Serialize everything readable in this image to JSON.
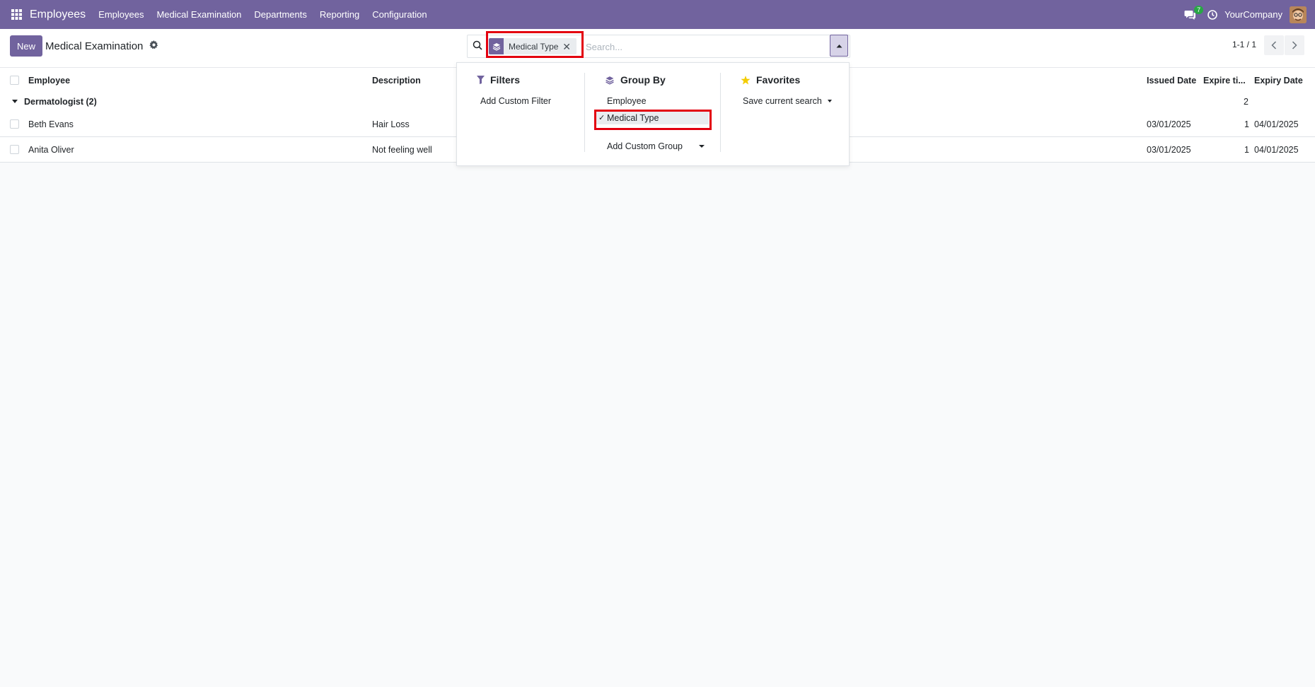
{
  "navbar": {
    "app_name": "Employees",
    "menu": [
      "Employees",
      "Medical Examination",
      "Departments",
      "Reporting",
      "Configuration"
    ],
    "chat_count": "7",
    "company": "YourCompany",
    "bg_color": "#71639e"
  },
  "control": {
    "new_label": "New",
    "title": "Medical Examination",
    "search": {
      "facet_label": "Medical Type",
      "placeholder": "Search..."
    },
    "pager": "1-1 / 1"
  },
  "list": {
    "columns": [
      "Employee",
      "Description",
      "Issued Date",
      "Expire ti...",
      "Expiry Date"
    ],
    "group": {
      "label": "Dermatologist (2)",
      "count": "2"
    },
    "rows": [
      {
        "employee": "Beth Evans",
        "description": "Hair Loss",
        "issued": "03/01/2025",
        "expire": "1",
        "expiry": "04/01/2025"
      },
      {
        "employee": "Anita Oliver",
        "description": "Not feeling well",
        "issued": "03/01/2025",
        "expire": "1",
        "expiry": "04/01/2025"
      }
    ]
  },
  "dropdown": {
    "filters": {
      "title": "Filters",
      "items": [
        "Add Custom Filter"
      ]
    },
    "group_by": {
      "title": "Group By",
      "items": [
        "Employee",
        "Medical Type"
      ],
      "selected": "Medical Type",
      "custom": "Add Custom Group"
    },
    "favorites": {
      "title": "Favorites",
      "items": [
        "Save current search"
      ]
    }
  },
  "highlight_color": "#e3000f"
}
